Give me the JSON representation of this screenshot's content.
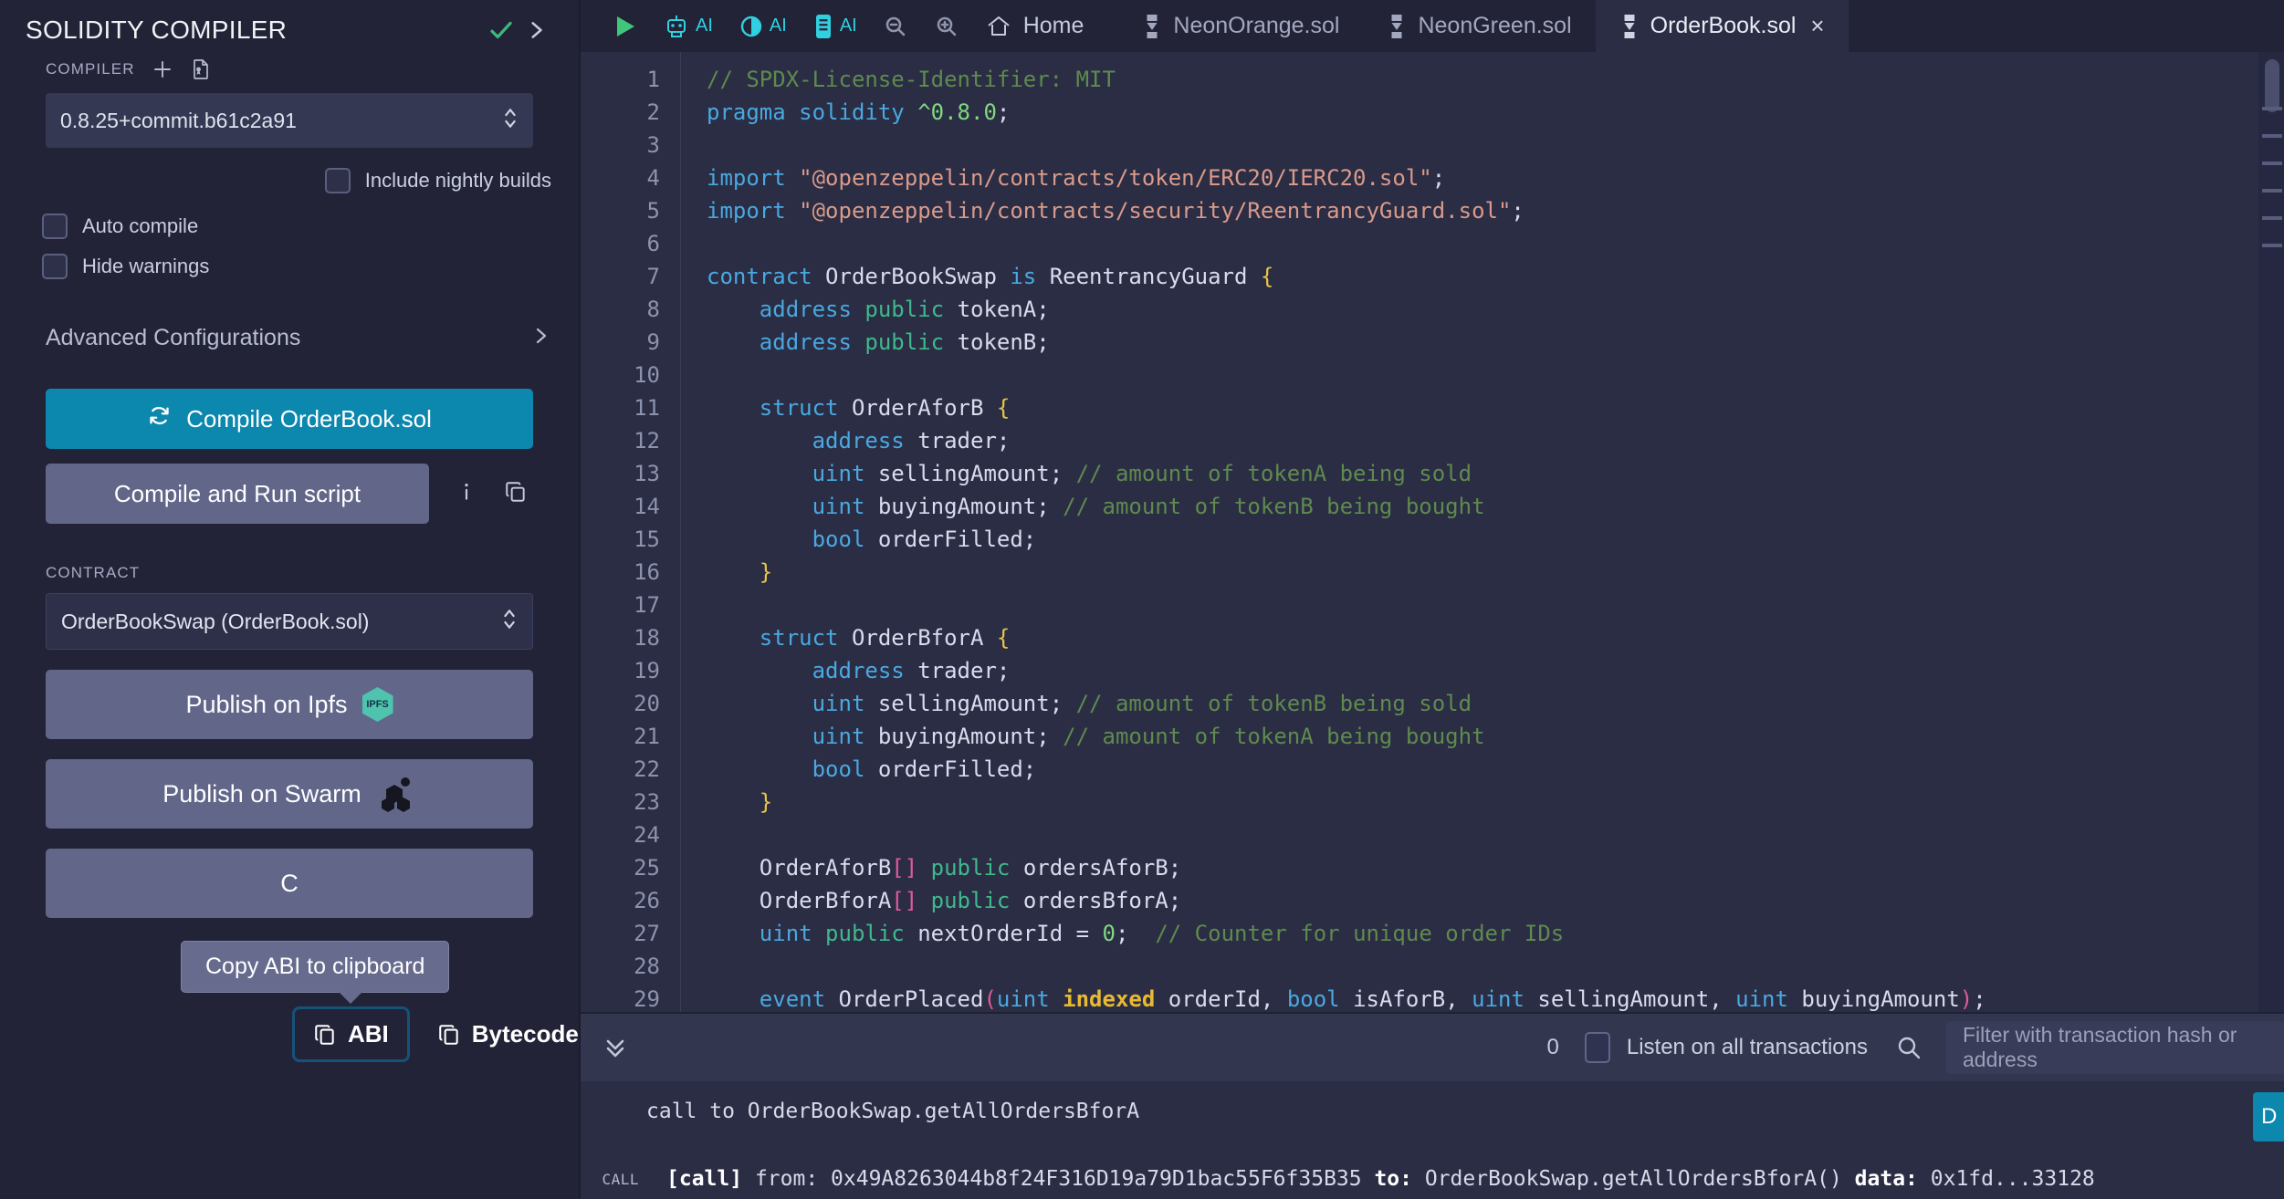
{
  "left_panel": {
    "title": "SOLIDITY COMPILER",
    "header_icons": {
      "check": "check-icon",
      "chevron": "chevron-right-icon"
    },
    "compiler_section_label": "COMPILER",
    "add_icon": "plus-icon",
    "file_icon": "certificate-file-icon",
    "compiler_version": "0.8.25+commit.b61c2a91",
    "nightly_label": "Include nightly builds",
    "auto_compile_label": "Auto compile",
    "hide_warnings_label": "Hide warnings",
    "advanced_label": "Advanced Configurations",
    "compile_button": "Compile OrderBook.sol",
    "compile_icon": "refresh-icon",
    "run_script_button": "Compile and Run script",
    "info_icon": "info-icon",
    "copy_icon": "copy-icon",
    "contract_section_label": "CONTRACT",
    "contract_value": "OrderBookSwap (OrderBook.sol)",
    "publish_ipfs": "Publish on Ipfs",
    "ipfs_badge": "IPFS",
    "publish_swarm": "Publish on Swarm",
    "copy_abi_partial": "C",
    "tooltip": "Copy ABI to clipboard",
    "abi_button": "ABI",
    "bytecode_button": "Bytecode"
  },
  "toolbar": {
    "run_icon": "play-icon",
    "items": [
      {
        "icon": "robot-icon",
        "label": "AI"
      },
      {
        "icon": "contrast-circle-icon",
        "label": "AI"
      },
      {
        "icon": "book-icon",
        "label": "AI"
      }
    ],
    "zoom_out_icon": "zoom-out-icon",
    "zoom_in_icon": "zoom-in-icon",
    "home_icon": "home-icon",
    "home_label": "Home",
    "tabs": [
      {
        "label": "NeonOrange.sol",
        "active": false,
        "closable": false
      },
      {
        "label": "NeonGreen.sol",
        "active": false,
        "closable": false
      },
      {
        "label": "OrderBook.sol",
        "active": true,
        "closable": true
      }
    ],
    "close_glyph": "×"
  },
  "editor": {
    "first_line": 1,
    "line_numbers": [
      1,
      2,
      3,
      4,
      5,
      6,
      7,
      8,
      9,
      10,
      11,
      12,
      13,
      14,
      15,
      16,
      17,
      18,
      19,
      20,
      21,
      22,
      23,
      24,
      25,
      26,
      27,
      28,
      29
    ],
    "lines": [
      "// SPDX-License-Identifier: MIT",
      "pragma solidity ^0.8.0;",
      "",
      "import \"@openzeppelin/contracts/token/ERC20/IERC20.sol\";",
      "import \"@openzeppelin/contracts/security/ReentrancyGuard.sol\";",
      "",
      "contract OrderBookSwap is ReentrancyGuard {",
      "    address public tokenA;",
      "    address public tokenB;",
      "",
      "    struct OrderAforB {",
      "        address trader;",
      "        uint sellingAmount; // amount of tokenA being sold",
      "        uint buyingAmount; // amount of tokenB being bought",
      "        bool orderFilled;",
      "    }",
      "",
      "    struct OrderBforA {",
      "        address trader;",
      "        uint sellingAmount; // amount of tokenB being sold",
      "        uint buyingAmount; // amount of tokenA being bought",
      "        bool orderFilled;",
      "    }",
      "",
      "    OrderAforB[] public ordersAforB;",
      "    OrderBforA[] public ordersBforA;",
      "    uint public nextOrderId = 0;  // Counter for unique order IDs",
      "",
      "    event OrderPlaced(uint indexed orderId, bool isAforB, uint sellingAmount, uint buyingAmount);"
    ]
  },
  "terminal": {
    "collapse_icon": "chevron-double-down-icon",
    "count": "0",
    "listen_label": "Listen on all transactions",
    "search_icon": "search-icon",
    "filter_placeholder": "Filter with transaction hash or address",
    "log_line": "call to OrderBookSwap.getAllOrdersBforA",
    "call_tag": "CALL",
    "call_prefix": "[call]",
    "call_from_label": "from:",
    "call_from_value": "0x49A8263044b8f24F316D19a79D1bac55F6f35B35",
    "call_to_label": "to:",
    "call_to_value": "OrderBookSwap.getAllOrdersBforA()",
    "call_data_label": "data:",
    "call_data_value": "0x1fd...33128"
  },
  "colors": {
    "accent": "#0c87ad",
    "panel_bg": "#222336",
    "editor_bg": "#2a2d44",
    "button_grey": "#62678a",
    "cyan": "#2fd0e0",
    "green_check": "#3cb878"
  }
}
